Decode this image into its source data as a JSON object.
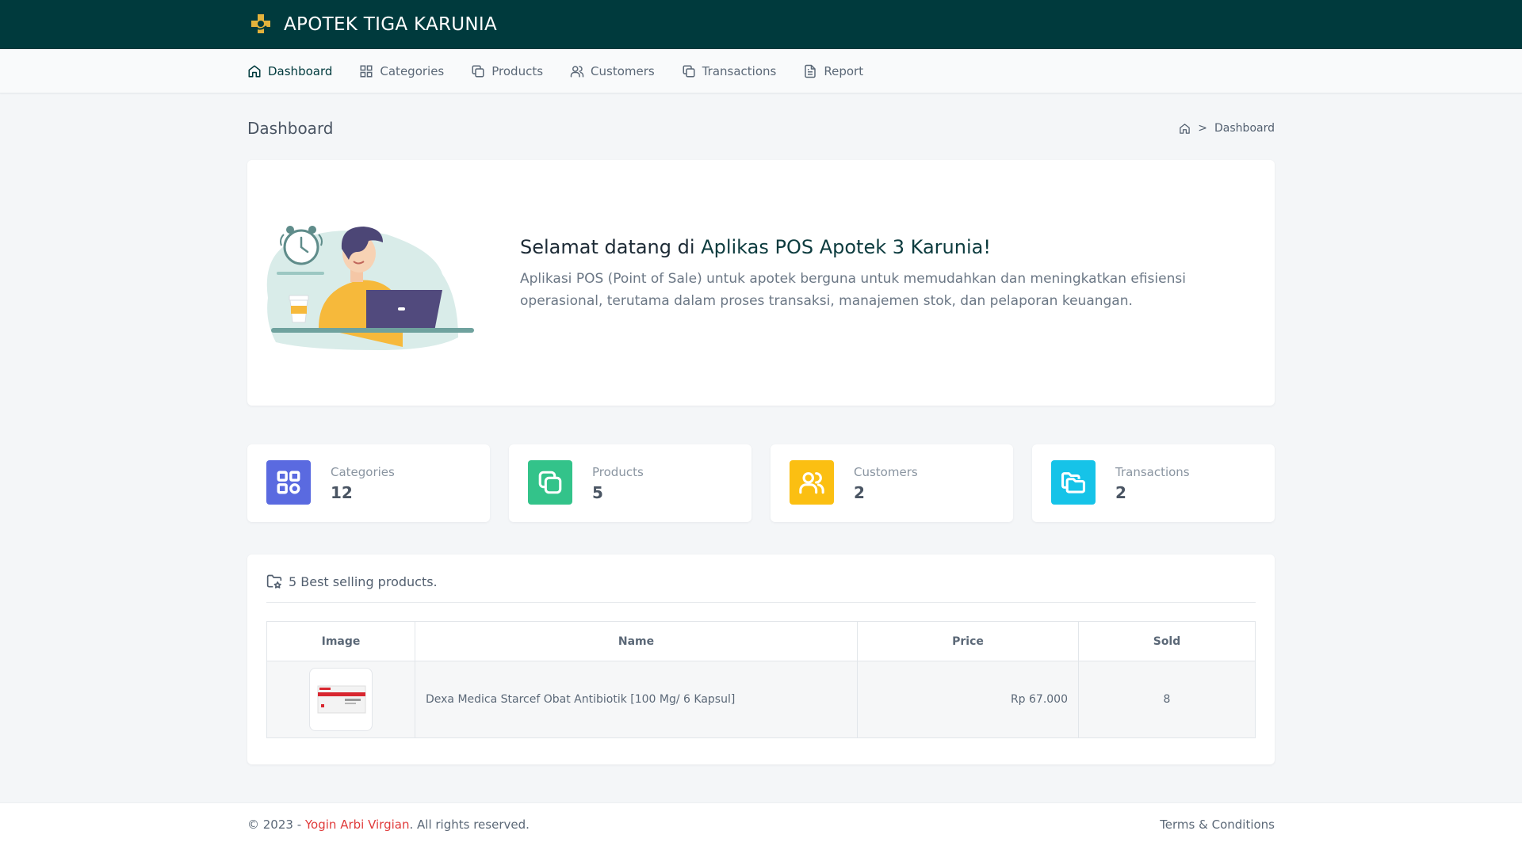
{
  "brand": {
    "name": "APOTEK TIGA KARUNIA"
  },
  "nav": {
    "items": [
      {
        "label": "Dashboard",
        "icon": "home-icon",
        "active": true
      },
      {
        "label": "Categories",
        "icon": "grid-icon"
      },
      {
        "label": "Products",
        "icon": "copy-icon"
      },
      {
        "label": "Customers",
        "icon": "users-icon"
      },
      {
        "label": "Transactions",
        "icon": "copy-icon"
      },
      {
        "label": "Report",
        "icon": "file-text-icon"
      }
    ]
  },
  "page": {
    "title": "Dashboard",
    "breadcrumb": {
      "sep": ">",
      "current": "Dashboard"
    }
  },
  "welcome": {
    "title_prefix": "Selamat datang di",
    "title_strong": "Aplikas POS Apotek 3 Karunia!",
    "description": "Aplikasi POS (Point of Sale) untuk apotek berguna untuk memudahkan dan meningkatkan efisiensi operasional, terutama dalam proses transaksi, manajemen stok, dan pelaporan keuangan."
  },
  "stats": [
    {
      "label": "Categories",
      "value": "12",
      "color": "#5a6ae0",
      "icon": "grid-icon"
    },
    {
      "label": "Products",
      "value": "5",
      "color": "#33c38a",
      "icon": "copy-icon"
    },
    {
      "label": "Customers",
      "value": "2",
      "color": "#fbbf12",
      "icon": "users-icon"
    },
    {
      "label": "Transactions",
      "value": "2",
      "color": "#16c3e8",
      "icon": "folders-icon"
    }
  ],
  "best_selling": {
    "title": "5 Best selling products.",
    "columns": [
      "Image",
      "Name",
      "Price",
      "Sold"
    ],
    "rows": [
      {
        "name": "Dexa Medica Starcef Obat Antibiotik [100 Mg/ 6 Kapsul]",
        "price": "Rp 67.000",
        "sold": "8"
      }
    ]
  },
  "footer": {
    "copyright_prefix": "© 2023 - ",
    "author": "Yogin Arbi Virgian",
    "copyright_suffix": ". All rights reserved.",
    "terms": "Terms & Conditions"
  },
  "colors": {
    "topbar": "#003a3d",
    "accent": "#003a3d",
    "author_link": "#e03b3b"
  }
}
